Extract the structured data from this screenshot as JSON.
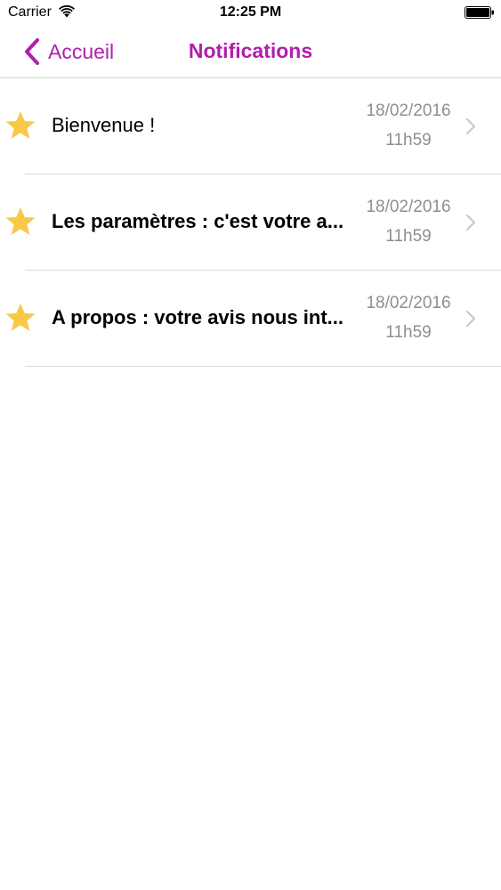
{
  "status_bar": {
    "carrier": "Carrier",
    "time": "12:25 PM",
    "wifi_icon": "wifi-icon",
    "battery_icon": "battery-icon"
  },
  "nav": {
    "back_label": "Accueil",
    "back_icon": "chevron-left-icon",
    "title": "Notifications",
    "accent_color": "#b01fae"
  },
  "notifications": [
    {
      "title": "Bienvenue !",
      "date": "18/02/2016",
      "time": "11h59",
      "icon": "star-icon",
      "unread": false
    },
    {
      "title": "Les paramètres : c'est votre a...",
      "date": "18/02/2016",
      "time": "11h59",
      "icon": "star-icon",
      "unread": true
    },
    {
      "title": "A propos : votre avis nous int...",
      "date": "18/02/2016",
      "time": "11h59",
      "icon": "star-icon",
      "unread": true
    }
  ],
  "colors": {
    "star": "#f9c846",
    "secondary_text": "#8e8e93",
    "chevron": "#c7c7cc"
  }
}
